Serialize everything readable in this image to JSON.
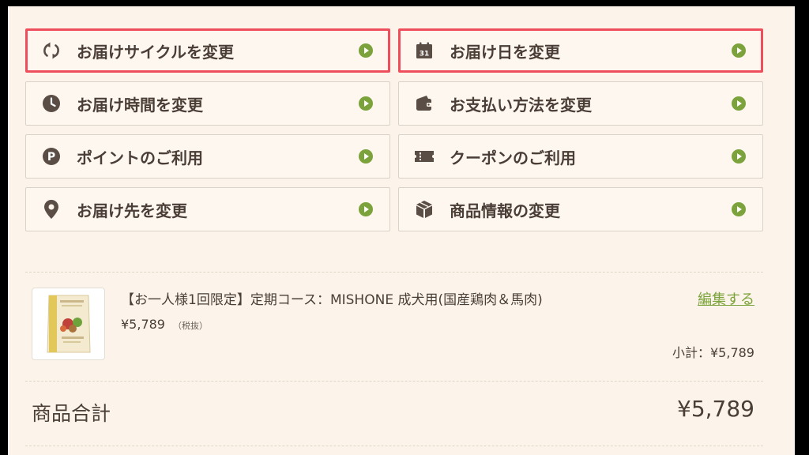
{
  "menu": {
    "cycle": {
      "label": "お届けサイクルを変更",
      "icon": "refresh-cycle-icon"
    },
    "date": {
      "label": "お届け日を変更",
      "icon": "calendar-icon",
      "calendar_day": "31"
    },
    "time": {
      "label": "お届け時間を変更",
      "icon": "clock-icon"
    },
    "payment": {
      "label": "お支払い方法を変更",
      "icon": "wallet-icon"
    },
    "points": {
      "label": "ポイントのご利用",
      "icon": "points-icon",
      "points_letter": "P"
    },
    "coupon": {
      "label": "クーポンのご利用",
      "icon": "ticket-icon"
    },
    "address": {
      "label": "お届け先を変更",
      "icon": "location-pin-icon"
    },
    "product_info": {
      "label": "商品情報の変更",
      "icon": "box-icon"
    }
  },
  "product": {
    "name": "【お一人様1回限定】定期コース：MISHONE 成犬用(国産鶏肉＆馬肉)",
    "price": "¥5,789",
    "tax_note": "（税抜）",
    "edit_label": "編集する",
    "subtotal": "小計：¥5,789"
  },
  "totals": {
    "label": "商品合計",
    "value": "¥5,789"
  },
  "colors": {
    "background": "#fcf4ea",
    "highlight_border": "#ee4e5c",
    "accent_green": "#7ca33b",
    "icon_brown": "#5a4d45"
  }
}
